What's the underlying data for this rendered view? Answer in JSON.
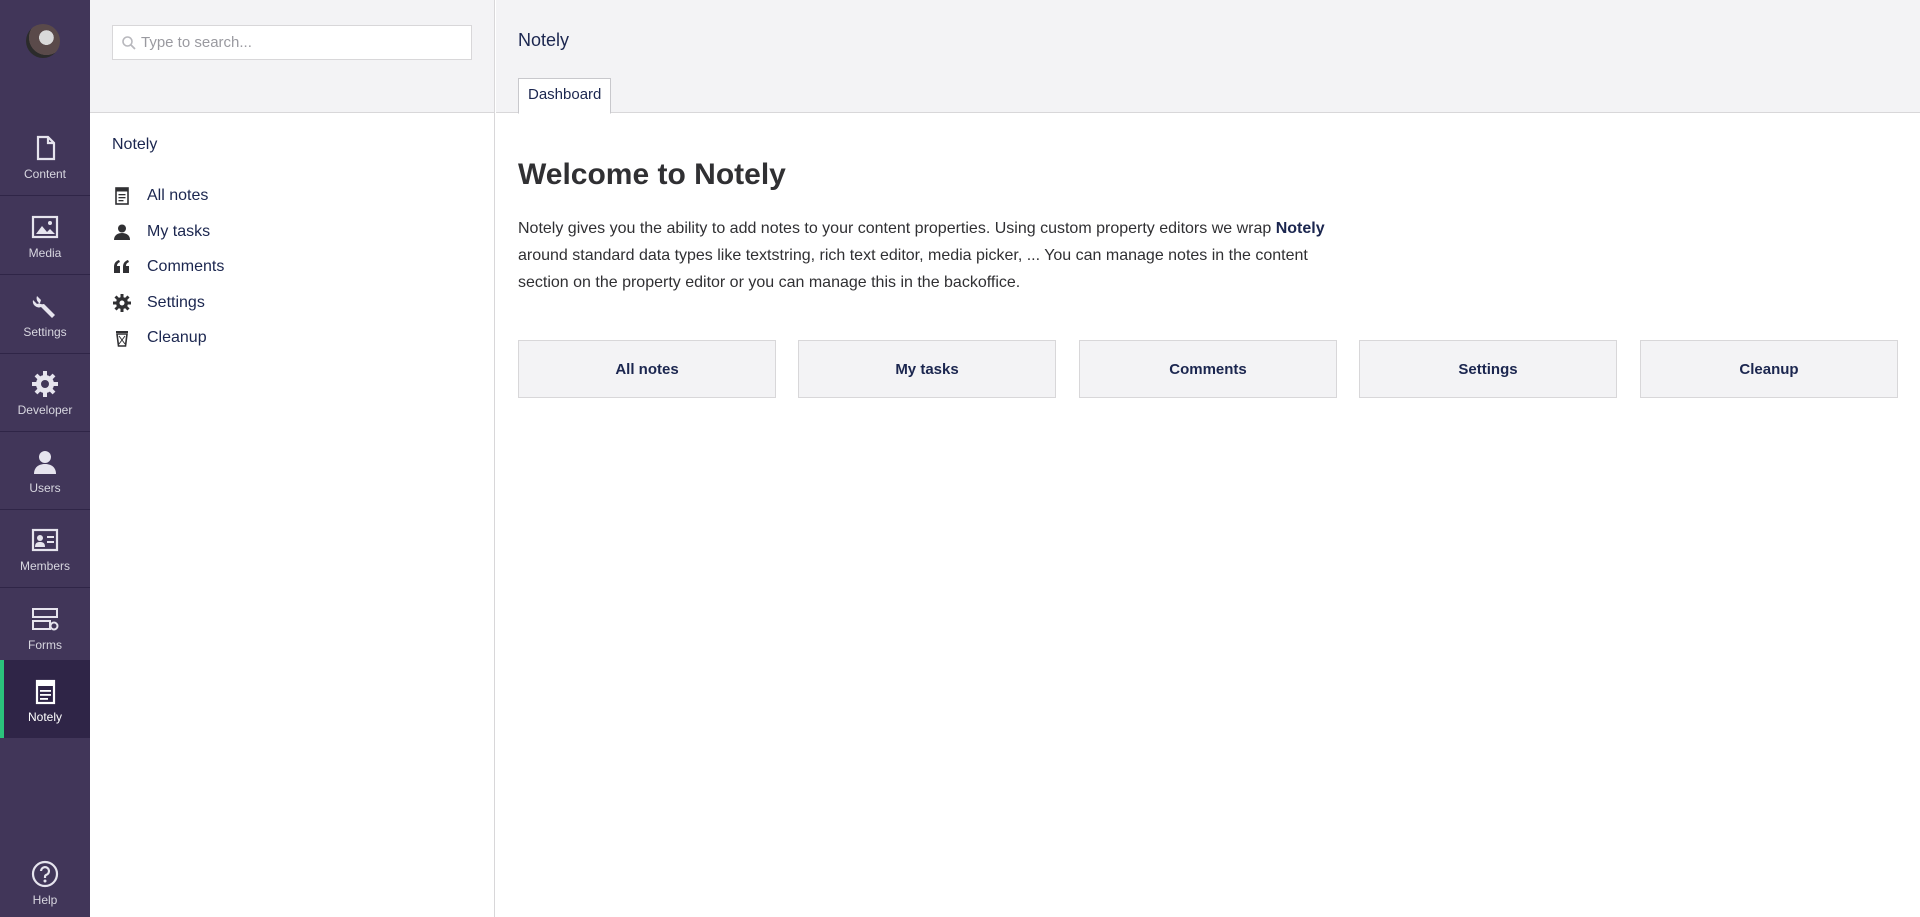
{
  "rail": {
    "items": [
      {
        "label": "Content",
        "icon": "document-icon"
      },
      {
        "label": "Media",
        "icon": "image-icon"
      },
      {
        "label": "Settings",
        "icon": "wrench-icon"
      },
      {
        "label": "Developer",
        "icon": "gear-icon"
      },
      {
        "label": "Users",
        "icon": "user-icon"
      },
      {
        "label": "Members",
        "icon": "id-card-icon"
      },
      {
        "label": "Forms",
        "icon": "form-icon"
      },
      {
        "label": "Notely",
        "icon": "notepad-icon",
        "active": true
      }
    ],
    "help_label": "Help"
  },
  "search": {
    "placeholder": "Type to search..."
  },
  "tree": {
    "title": "Notely",
    "items": [
      {
        "label": "All notes",
        "icon": "notepad-icon"
      },
      {
        "label": "My tasks",
        "icon": "user-icon"
      },
      {
        "label": "Comments",
        "icon": "quote-icon"
      },
      {
        "label": "Settings",
        "icon": "gear-icon"
      },
      {
        "label": "Cleanup",
        "icon": "trash-icon"
      }
    ]
  },
  "main": {
    "title": "Notely",
    "tab": "Dashboard",
    "heading": "Welcome to Notely",
    "intro_before": "Notely gives you the ability to add notes to your content properties. Using custom property editors we wrap ",
    "intro_bold": "Notely",
    "intro_after": " around standard data types like textstring, rich text editor, media picker, ... You can manage notes in the content section on the property editor or you can manage this in the backoffice.",
    "buttons": [
      "All notes",
      "My tasks",
      "Comments",
      "Settings",
      "Cleanup"
    ]
  },
  "colors": {
    "rail": "#413659",
    "active_accent": "#2bc37c",
    "panel_bg": "#f3f3f5"
  }
}
